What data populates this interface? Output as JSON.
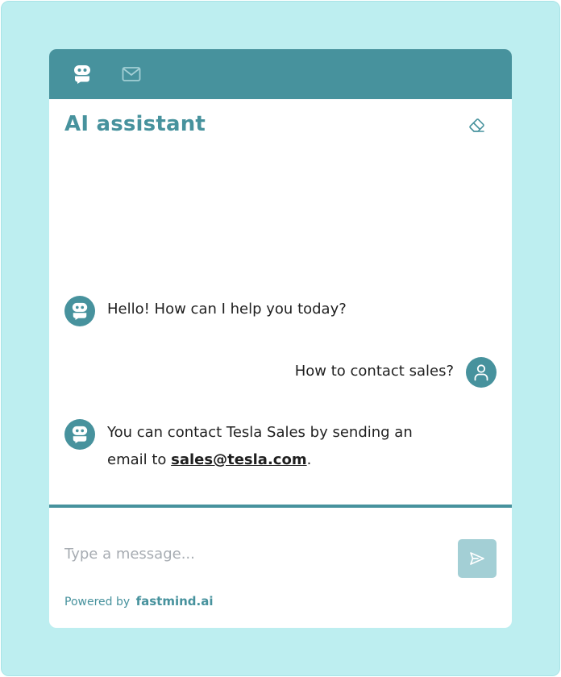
{
  "header": {
    "tabs": [
      {
        "name": "assistant",
        "icon": "robot-icon",
        "active": true
      },
      {
        "name": "mail",
        "icon": "mail-icon",
        "active": false
      }
    ]
  },
  "chat": {
    "title": "AI assistant",
    "clear_icon": "eraser-icon",
    "messages": [
      {
        "role": "assistant",
        "text": "Hello! How can I help you today?"
      },
      {
        "role": "user",
        "text": "How to contact sales?"
      },
      {
        "role": "assistant",
        "text_before": "You can contact Tesla Sales by sending an",
        "text_line2_before": "email to ",
        "link": "sales@tesla.com",
        "text_after": "."
      }
    ]
  },
  "composer": {
    "placeholder": "Type a message...",
    "send_icon": "send-icon"
  },
  "footer": {
    "powered_by": "Powered by",
    "brand": "fastmind.ai"
  },
  "colors": {
    "accent": "#47929d",
    "backdrop": "#bdeef0",
    "send_button": "#a3cfd5",
    "placeholder": "#a7acb2"
  }
}
